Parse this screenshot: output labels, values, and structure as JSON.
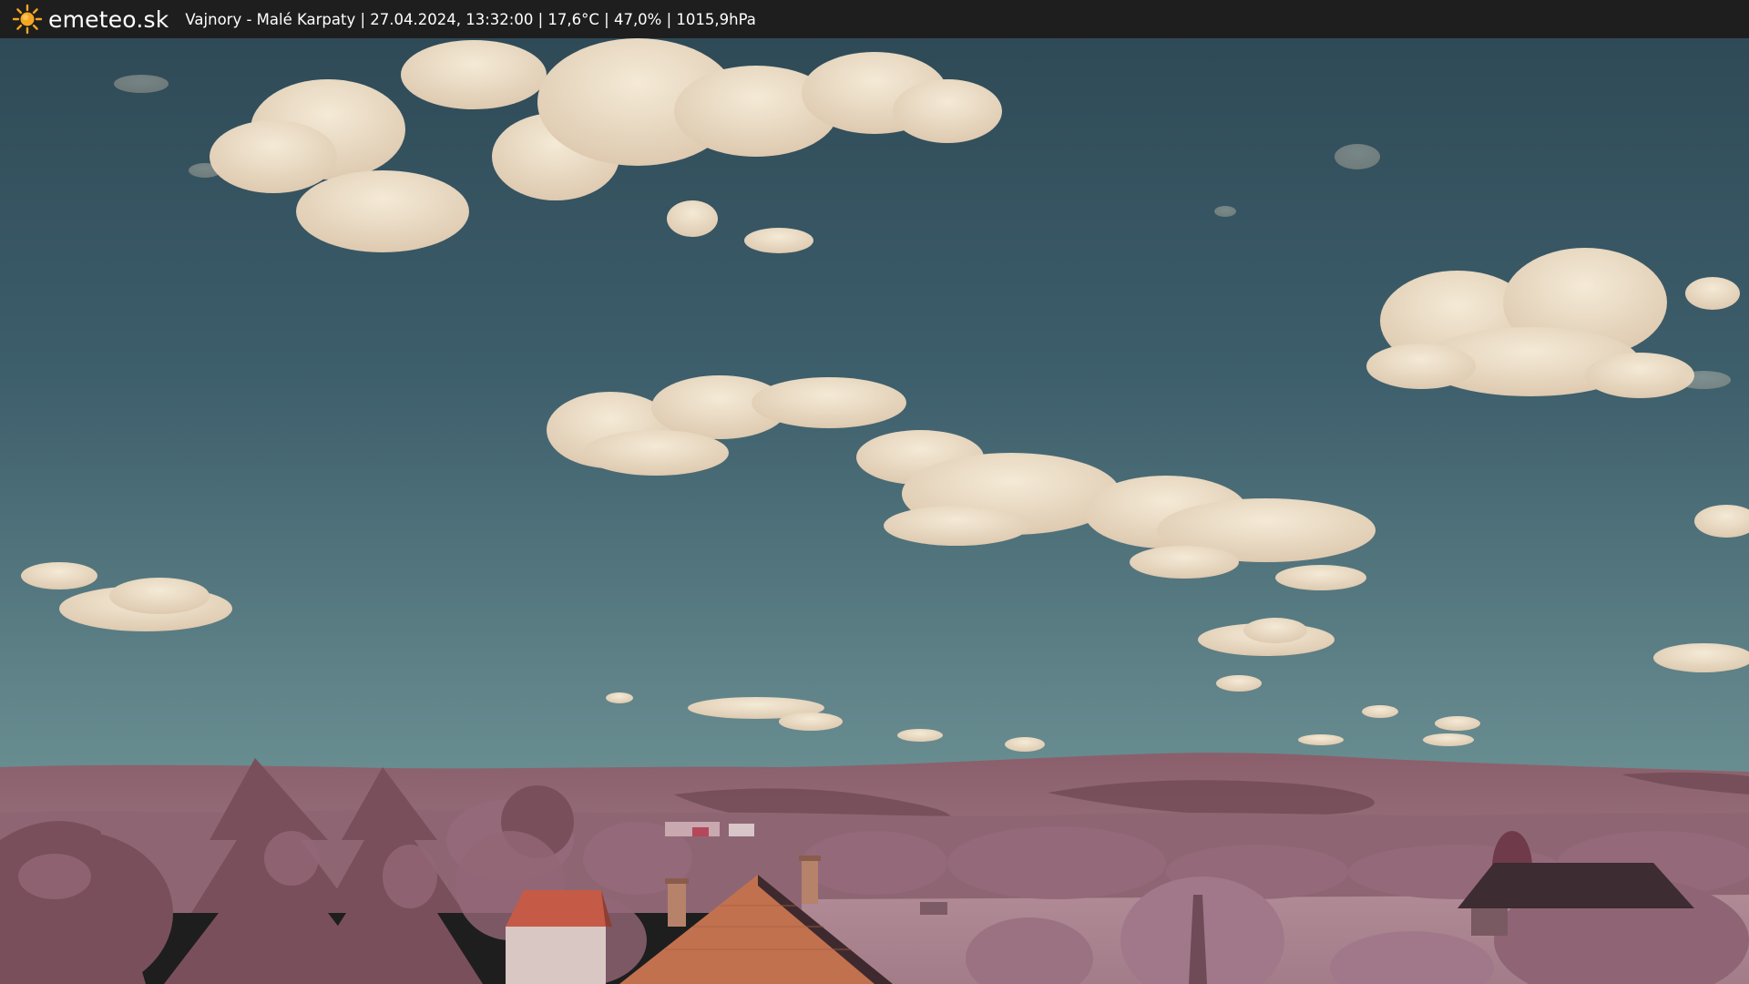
{
  "header": {
    "brand": "emeteo.sk",
    "brand_icon": "sun-icon",
    "caption": "Vajnory - Malé Karpaty | 27.04.2024, 13:32:00 | 17,6°C | 47,0% | 1015,9hPa"
  },
  "colors": {
    "bar": "#1e1e1e",
    "sun": "#f5a623",
    "sky_top": "#2f4a57",
    "sky_bottom": "#5b8289",
    "cloud": "#efe3cc",
    "hills": "#8c6470",
    "foliage": "#9a6f7b"
  }
}
